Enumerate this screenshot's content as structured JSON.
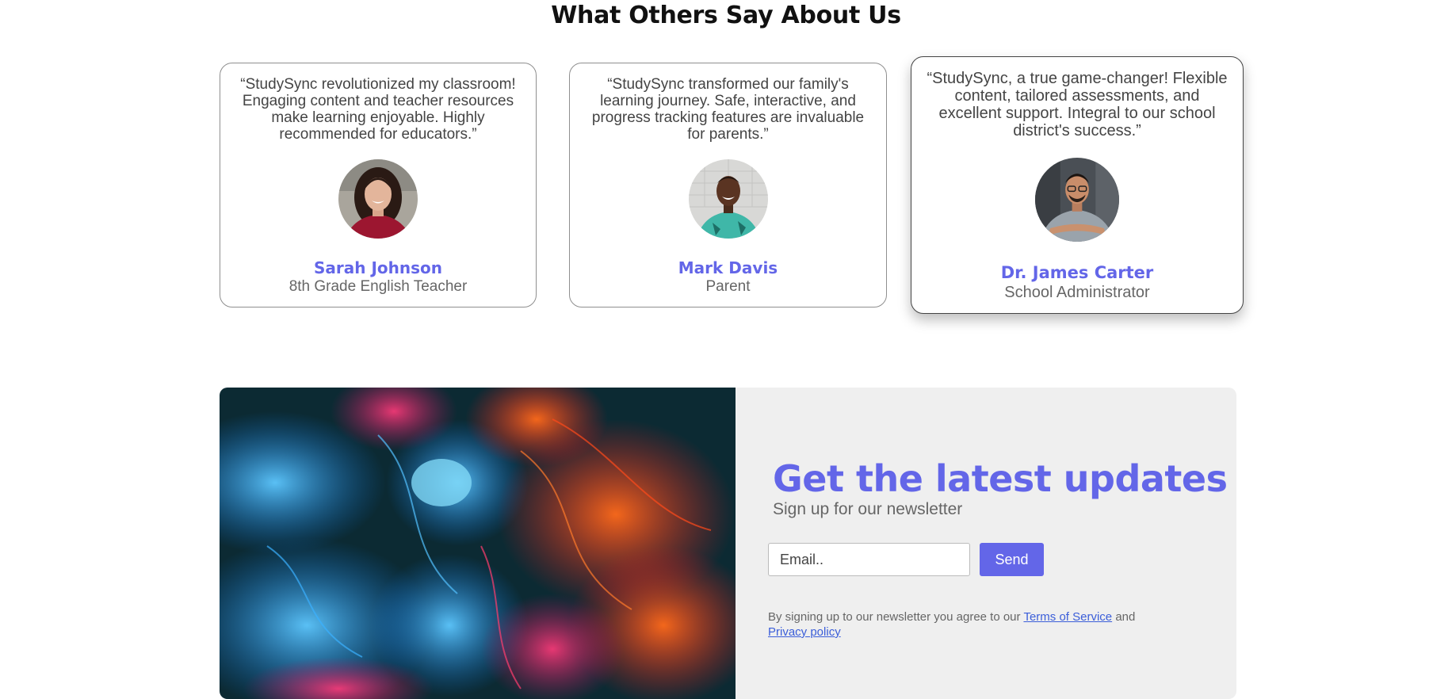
{
  "section": {
    "title": "What Others Say About Us"
  },
  "testimonials": [
    {
      "quote": "“StudySync revolutionized my classroom! Engaging content and teacher resources make learning enjoyable. Highly recommended for educators.”",
      "name": "Sarah Johnson",
      "role": "8th Grade English Teacher"
    },
    {
      "quote": "“StudySync transformed our family's learning journey. Safe, interactive, and progress tracking features are invaluable for parents.”",
      "name": "Mark Davis",
      "role": "Parent"
    },
    {
      "quote": "“StudySync, a true game-changer! Flexible content, tailored assessments, and excellent support. Integral to our school district's success.”",
      "name": "Dr. James Carter",
      "role": "School Administrator"
    }
  ],
  "newsletter": {
    "title": "Get the latest updates",
    "subtitle": "Sign up for our newsletter",
    "email_placeholder": "Email..",
    "email_value": "",
    "send_label": "Send",
    "legal_prefix": "By signing up to our newsletter you agree to our",
    "terms_label": "Terms of Service",
    "and_label": "and",
    "privacy_label": "Privacy policy"
  },
  "colors": {
    "accent": "#6366e8",
    "link": "#3b5ed9",
    "panel_bg": "#efefef"
  }
}
